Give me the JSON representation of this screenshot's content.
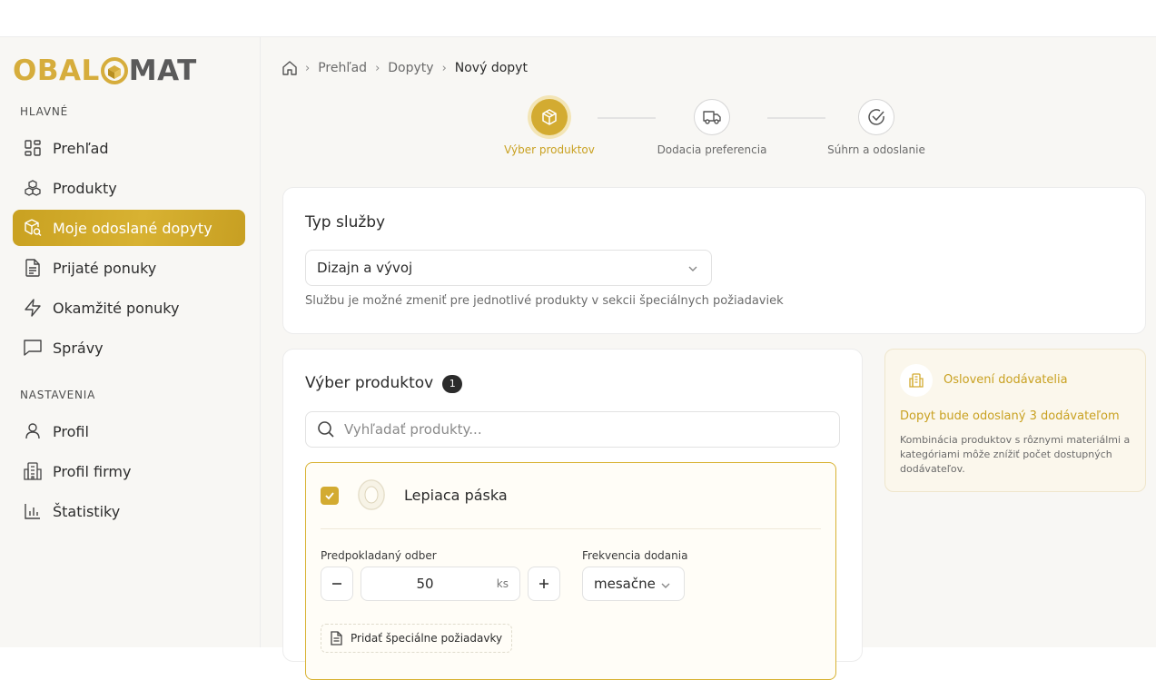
{
  "logo": {
    "part1": "OBAL",
    "part2": "MAT"
  },
  "sidebar": {
    "main_label": "HLAVNÉ",
    "settings_label": "NASTAVENIA",
    "items": [
      {
        "label": "Prehľad",
        "icon": "dashboard-icon"
      },
      {
        "label": "Produkty",
        "icon": "boxes-icon"
      },
      {
        "label": "Moje odoslané dopyty",
        "icon": "package-search-icon",
        "active": true
      },
      {
        "label": "Prijaté ponuky",
        "icon": "document-icon"
      },
      {
        "label": "Okamžité ponuky",
        "icon": "lightning-icon"
      },
      {
        "label": "Správy",
        "icon": "message-icon"
      }
    ],
    "settings_items": [
      {
        "label": "Profil",
        "icon": "user-icon"
      },
      {
        "label": "Profil firmy",
        "icon": "building-icon"
      },
      {
        "label": "Štatistiky",
        "icon": "bar-chart-icon"
      }
    ]
  },
  "breadcrumb": {
    "items": [
      "Prehľad",
      "Dopyty"
    ],
    "current": "Nový dopyt"
  },
  "stepper": [
    {
      "label": "Výber produktov",
      "icon": "box-icon",
      "active": true
    },
    {
      "label": "Dodacia preferencia",
      "icon": "truck-icon",
      "active": false
    },
    {
      "label": "Súhrn a odoslanie",
      "icon": "check-circle-icon",
      "active": false
    }
  ],
  "service": {
    "title": "Typ služby",
    "selected": "Dizajn a vývoj",
    "helper": "Službu je možné zmeniť pre jednotlivé produkty v sekcii špeciálnych požiadaviek"
  },
  "products": {
    "title": "Výber produktov",
    "count": "1",
    "search_placeholder": "Vyhľadať produkty...",
    "item": {
      "name": "Lepiaca páska",
      "checked": true,
      "quantity_label": "Predpokladaný odber",
      "quantity": "50",
      "unit": "ks",
      "frequency_label": "Frekvencia dodania",
      "frequency": "mesačne",
      "special_button": "Pridať špeciálne požiadavky"
    }
  },
  "suppliers": {
    "title": "Oslovení dodávatelia",
    "headline": "Dopyt bude odoslaný 3 dodávateľom",
    "note": "Kombinácia produktov s rôznymi materiálmi a kategóriami môže znížiť počet dostupných dodávateľov."
  },
  "colors": {
    "accent": "#d3ab31",
    "accent_light": "#f3e5b6",
    "sidebar_bg": "#f8f7f4",
    "text": "#2b2b2b"
  }
}
